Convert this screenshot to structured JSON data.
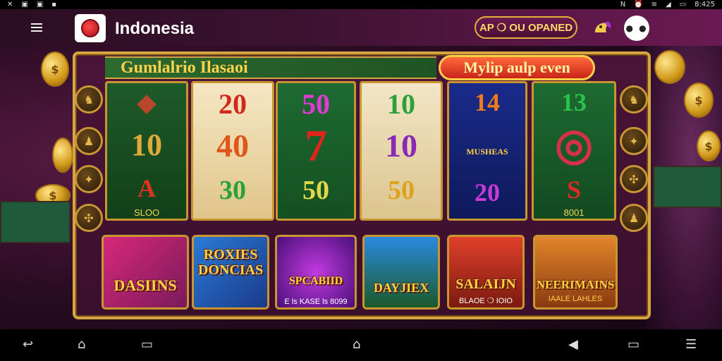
{
  "status_bar": {
    "left_icons": [
      "close-icon",
      "image-icon",
      "image-icon",
      "notification-icon"
    ],
    "right_icons": [
      "nfc-icon",
      "alarm-icon",
      "wifi-icon",
      "signal-icon",
      "battery-icon"
    ],
    "time": "8:425",
    "left_glyphs": [
      "✕",
      "▣",
      "▣",
      "▪"
    ],
    "right_glyphs": [
      "N",
      "⏰",
      "≋",
      "◢",
      "▭"
    ]
  },
  "app_bar": {
    "title": "Indonesia",
    "promo_label": "AP ❍ OU OPANED",
    "menu_icon": "hamburger-icon",
    "logo_icon": "casino-logo-icon",
    "bird_icon": "parrot-icon",
    "ghost_icon": "ghost-icon"
  },
  "machine": {
    "jackpot_title": "Gumlalrio Ilasaoi",
    "multiplier_label": "Mylip aulp even",
    "left_buttons": [
      "♞",
      "♟",
      "✦",
      "✣"
    ],
    "right_buttons": [
      "♞",
      "✦",
      "✣",
      "♟"
    ]
  },
  "reels": [
    {
      "top": "◆",
      "middle": "10",
      "bottom": "A",
      "caption": "SLOO"
    },
    {
      "top": "20",
      "middle": "40",
      "bottom": "30",
      "caption": ""
    },
    {
      "top": "50",
      "middle": "7",
      "bottom": "50",
      "caption": ""
    },
    {
      "top": "10",
      "middle": "10",
      "bottom": "50",
      "caption": ""
    },
    {
      "top": "14",
      "middle": "MUSHEAS",
      "bottom": "20",
      "caption": ""
    },
    {
      "top": "13",
      "middle": "◎",
      "bottom": "S",
      "caption": "8001"
    }
  ],
  "tiles": [
    {
      "title": "DASIINS",
      "subtitle": ""
    },
    {
      "title": "ROXIES DONCIAS",
      "subtitle": ""
    },
    {
      "title": "SPCABIID",
      "subtitle": "E ls KASE ls 8099"
    },
    {
      "title": "DAYJIEX",
      "subtitle": ""
    },
    {
      "title": "SALAIJN",
      "subtitle": "BLAOE ❍ IOIO"
    },
    {
      "title": "NEERIMAINS",
      "subtitle": "IAALE LAHLES"
    }
  ],
  "nav_bar": {
    "icons": [
      "back-icon",
      "home-icon",
      "recent-apps-icon",
      "home-icon",
      "volume-icon",
      "recent-apps-icon",
      "screenshot-icon"
    ],
    "glyphs": [
      "↩",
      "⌂",
      "▭",
      "⌂",
      "◀",
      "▭",
      "☰"
    ]
  }
}
